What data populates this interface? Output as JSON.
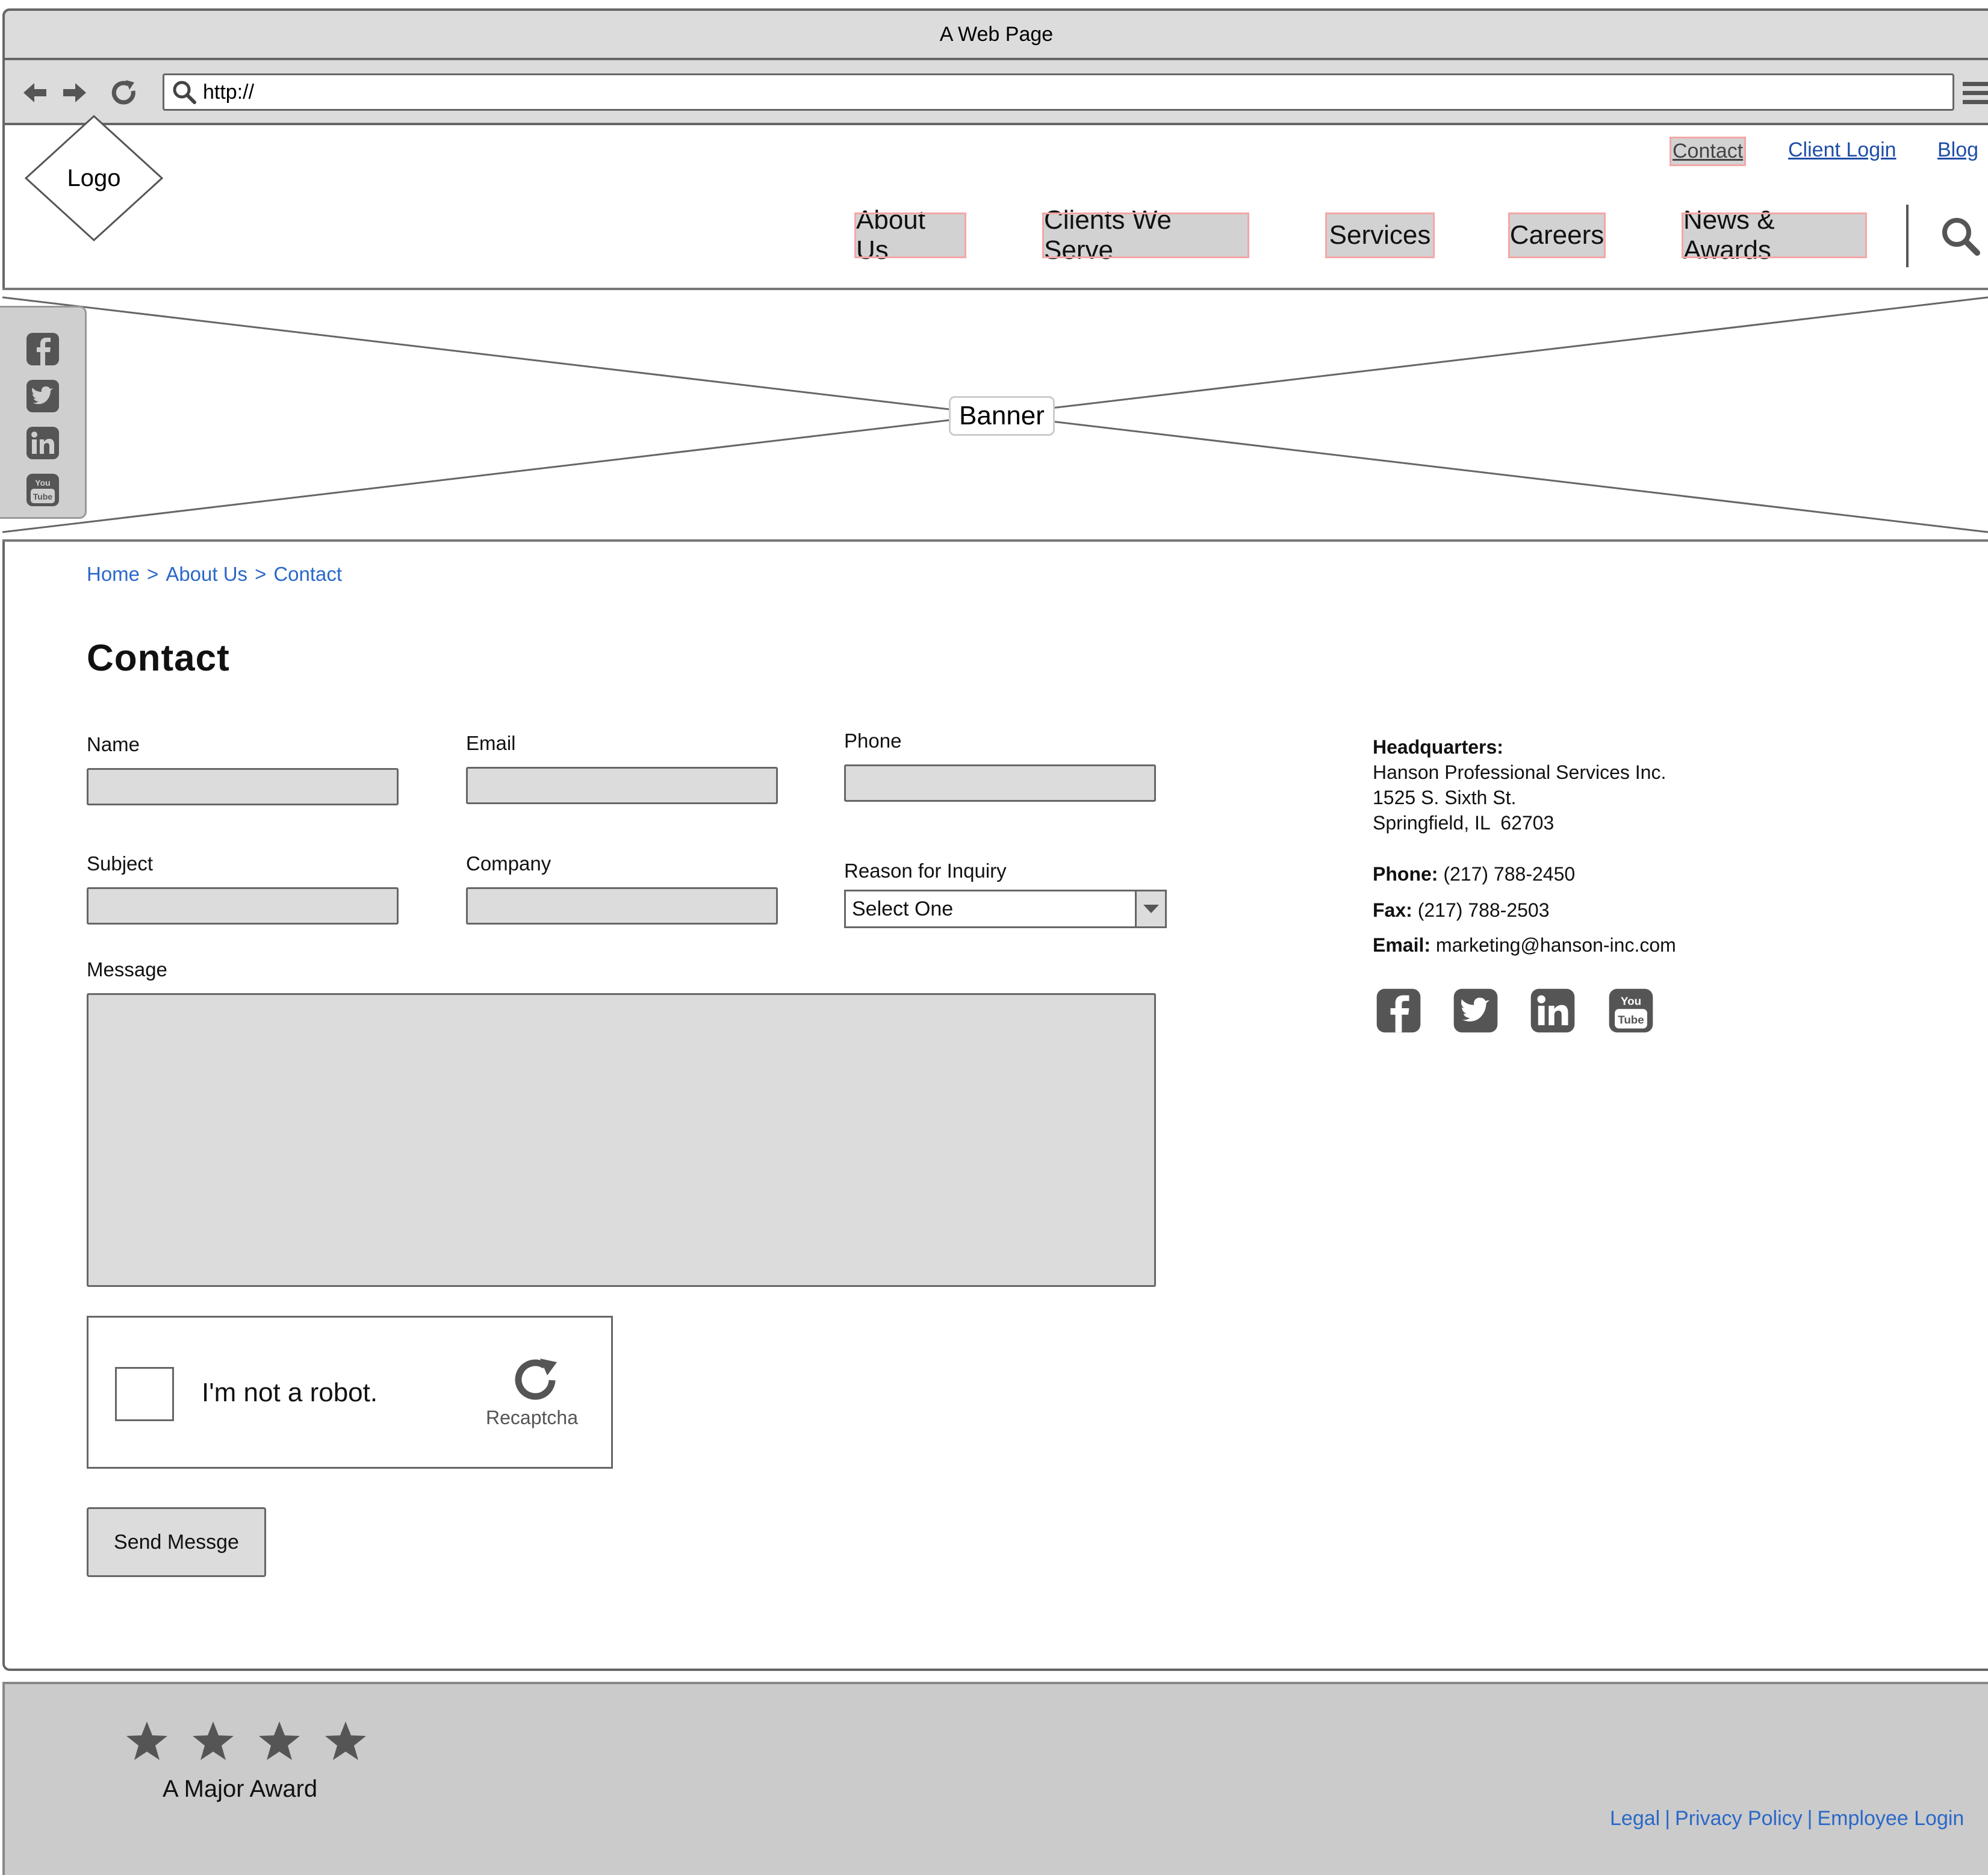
{
  "browser": {
    "title": "A Web Page",
    "url": "http://",
    "icons": [
      "back-arrow-icon",
      "forward-arrow-icon",
      "refresh-icon",
      "search-icon",
      "hamburger-menu-icon"
    ]
  },
  "site": {
    "logo": "Logo",
    "utility_nav": [
      "Contact",
      "Client Login",
      "Blog"
    ],
    "main_nav": [
      "About Us",
      "Clients We Serve",
      "Services",
      "Careers",
      "News & Awards"
    ],
    "banner": "Banner",
    "social_icons": [
      "facebook-icon",
      "twitter-icon",
      "linkedin-icon",
      "youtube-icon"
    ]
  },
  "breadcrumb": [
    "Home",
    "About Us",
    "Contact"
  ],
  "breadcrumb_separator": ">",
  "page_title": "Contact",
  "form": {
    "name_label": "Name",
    "email_label": "Email",
    "phone_label": "Phone",
    "subject_label": "Subject",
    "company_label": "Company",
    "reason_label": "Reason for Inquiry",
    "reason_value": "Select One",
    "message_label": "Message",
    "captcha_text": "I'm not a robot.",
    "captcha_brand": "Recaptcha",
    "submit_label": "Send Messge"
  },
  "headquarters": {
    "heading": "Headquarters:",
    "company": "Hanson Professional Services Inc.",
    "street": "1525 S. Sixth St.",
    "city": "Springfield, IL  62703",
    "phone_label": "Phone:",
    "phone": "(217) 788-2450",
    "fax_label": "Fax:",
    "fax": "(217) 788-2503",
    "email_label": "Email:",
    "email": "marketing@hanson-inc.com"
  },
  "footer": {
    "award_stars": 4,
    "award_label": "A Major Award",
    "links": [
      "Legal",
      "Privacy Policy",
      "Employee Login"
    ],
    "link_separator": "|"
  },
  "colors": {
    "link": "#2a68c8",
    "active_highlight": "#d2d2d2",
    "highlight_border": "#f4a7a7",
    "field_fill": "#dcdcdc",
    "footer_fill": "#cbcbcb",
    "icon_gray": "#555555"
  }
}
